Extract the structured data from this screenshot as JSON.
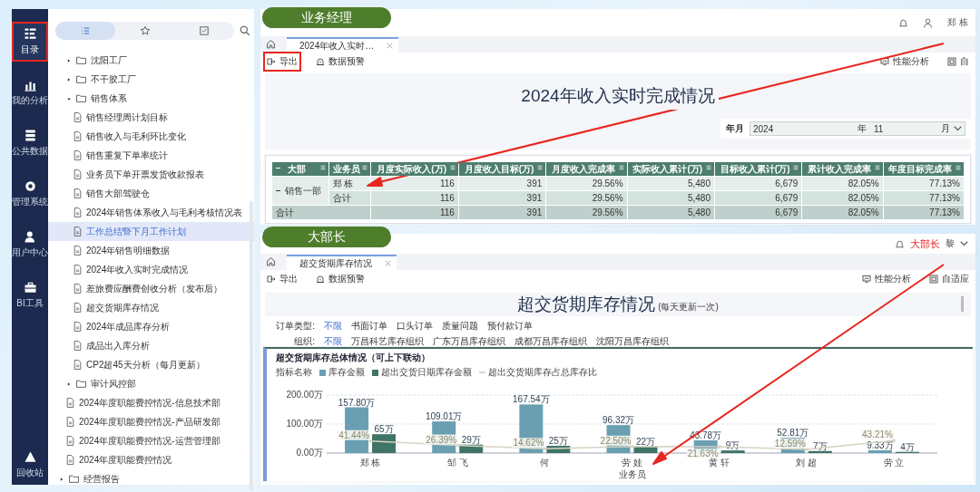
{
  "nav": {
    "items": [
      {
        "label": "目录",
        "selected": true,
        "highlighted": true
      },
      {
        "label": "我的分析",
        "selected": false,
        "highlighted": false
      },
      {
        "label": "公共数据",
        "selected": false,
        "highlighted": false
      },
      {
        "label": "管理系统",
        "selected": false,
        "highlighted": false
      },
      {
        "label": "用户中心",
        "selected": false,
        "highlighted": false
      },
      {
        "label": "BI工具",
        "selected": false,
        "highlighted": false
      }
    ],
    "bottom_item": {
      "label": "回收站"
    }
  },
  "tree": {
    "tabs": [
      {
        "selected": true
      },
      {
        "selected": false
      },
      {
        "selected": false
      }
    ],
    "items": [
      {
        "kind": "folder",
        "label": "沈阳工厂",
        "expanded": false,
        "selected": false
      },
      {
        "kind": "folder",
        "label": "不干胶工厂",
        "expanded": false,
        "selected": false
      },
      {
        "kind": "folder",
        "label": "销售体系",
        "expanded": true,
        "selected": false,
        "children": [
          {
            "kind": "file",
            "label": "销售经理周计划目标",
            "selected": false
          },
          {
            "kind": "file",
            "label": "销售收入与毛利环比变化",
            "selected": false
          },
          {
            "kind": "file",
            "label": "销售重复下单率统计",
            "selected": false
          },
          {
            "kind": "file",
            "label": "业务员下单开票发货收款报表",
            "selected": false
          },
          {
            "kind": "file",
            "label": "销售大部驾驶仓",
            "selected": false
          },
          {
            "kind": "file",
            "label": "2024年销售体系收入与毛利考核情况表",
            "selected": false
          },
          {
            "kind": "file",
            "label": "工作总结暨下月工作计划",
            "selected": true
          },
          {
            "kind": "file",
            "label": "2024年销售明细数据",
            "selected": false
          },
          {
            "kind": "file",
            "label": "2024年收入实时完成情况",
            "selected": false
          },
          {
            "kind": "file",
            "label": "差旅费应酬费创收分析（发布后）",
            "selected": false
          },
          {
            "kind": "file",
            "label": "超交货期库存情况",
            "selected": false
          },
          {
            "kind": "file",
            "label": "2024年成品库存分析",
            "selected": false
          },
          {
            "kind": "file",
            "label": "成品出入库分析",
            "selected": false
          },
          {
            "kind": "file",
            "label": "CP2超45天分析（每月更新）",
            "selected": false
          }
        ]
      },
      {
        "kind": "folder",
        "label": "审计风控部",
        "expanded": false,
        "selected": false
      },
      {
        "kind": "file",
        "label": "2024年度职能费控情况-信息技术部",
        "selected": false
      },
      {
        "kind": "file",
        "label": "2024年度职能费控情况-产品研发部",
        "selected": false
      },
      {
        "kind": "file",
        "label": "2024年度职能费控情况-运营管理部",
        "selected": false
      },
      {
        "kind": "file",
        "label": "2024年度职能费控情况",
        "selected": false
      }
    ],
    "root_items": [
      {
        "kind": "folder",
        "label": "经营报告",
        "expanded": false,
        "selected": false
      }
    ]
  },
  "panels": [
    {
      "role": "业务经理",
      "user": "郑 栋",
      "tab": "2024年收入实时…",
      "toolbar": [
        {
          "label": "导出",
          "highlighted": true
        },
        {
          "label": "数据预警",
          "highlighted": false
        }
      ],
      "toolbar_right": [
        {
          "label": "性能分析"
        },
        {
          "label": "自"
        }
      ],
      "report": {
        "kind": "table",
        "title": "2024年收入实时完成情况",
        "filter": {
          "label": "年月",
          "year": "2024",
          "year_unit": "年",
          "month": "11",
          "month_unit": "月"
        },
        "columns": [
          "大部",
          "业务员",
          "月度实际收入(万)",
          "月度收入目标(万)",
          "月度收入完成率",
          "实际收入累计(万)",
          "目标收入累计(万)",
          "累计收入完成率",
          "年度目标完成率"
        ],
        "groups": [
          {
            "name": "销售一部",
            "expanded": true,
            "rows": [
              {
                "person": "郑 栋",
                "values": [
                  "116",
                  "391",
                  "29.56%",
                  "5,480",
                  "6,679",
                  "82.05%",
                  "77.13%"
                ]
              },
              {
                "person": "合计",
                "values": [
                  "116",
                  "391",
                  "29.56%",
                  "5,480",
                  "6,679",
                  "82.05%",
                  "77.13%"
                ]
              }
            ]
          }
        ],
        "total": {
          "label": "合计",
          "values": [
            "116",
            "391",
            "29.56%",
            "5,480",
            "6,679",
            "82.05%",
            "77.13%"
          ]
        }
      }
    },
    {
      "role": "大部长",
      "role_note": "大部长",
      "user": "黎",
      "tab": "超交货期库存情况",
      "toolbar": [
        {
          "label": "导出",
          "highlighted": false
        },
        {
          "label": "数据预警",
          "highlighted": false
        }
      ],
      "toolbar_right": [
        {
          "label": "性能分析"
        },
        {
          "label": "自适应"
        }
      ],
      "report": {
        "kind": "chart",
        "title": "超交货期库存情况",
        "subtitle": "(每天更新一次)",
        "filters": [
          {
            "label": "订单类型:",
            "options": [
              {
                "label": "不限",
                "selected": true
              },
              {
                "label": "书面订单",
                "selected": false
              },
              {
                "label": "口头订单",
                "selected": false
              },
              {
                "label": "质量问题",
                "selected": false
              },
              {
                "label": "预付款订单",
                "selected": false
              }
            ]
          },
          {
            "label": "组织:",
            "options": [
              {
                "label": "不限",
                "selected": true
              },
              {
                "label": "万昌科艺库存组织",
                "selected": false
              },
              {
                "label": "广东万昌库存组织",
                "selected": false
              },
              {
                "label": "成都万昌库存组织",
                "selected": false
              },
              {
                "label": "沈阳万昌库存组织",
                "selected": false
              }
            ]
          }
        ],
        "card_title": "超交货期库存总体情况（可上下联动）",
        "legend_label": "指标名称",
        "chart_data": {
          "type": "bar",
          "stacked": false,
          "xlabel": "业务员",
          "categories": [
            "郑 栋",
            "邹 飞",
            "何",
            "劳 娃",
            "黄 轩",
            "刘 超",
            "劳 立"
          ],
          "ylim": [
            0,
            200
          ],
          "yticks": [
            {
              "value": 0,
              "label": "0.00万"
            },
            {
              "value": 100,
              "label": "100.00万"
            },
            {
              "value": 200,
              "label": "200.00万"
            }
          ],
          "series": [
            {
              "name": "库存金额",
              "type": "bar",
              "color": "#6a9fb2",
              "values": [
                157.8,
                109.01,
                167.54,
                96.32,
                43.78,
                52.81,
                9.33
              ],
              "value_labels": [
                "157.80万",
                "109.01万",
                "167.54万",
                "96.32万",
                "43.78万",
                "52.81万",
                "9.33万"
              ]
            },
            {
              "name": "超出交货日期库存金额",
              "type": "bar",
              "color": "#3f7466",
              "values": [
                65,
                29,
                25,
                22,
                9,
                7,
                4
              ],
              "value_labels": [
                "65万",
                "29万",
                "25万",
                "22万",
                "9万",
                "7万",
                "4万"
              ]
            },
            {
              "name": "超出交货期库存占总库存比",
              "type": "line",
              "color": "#d6d3c4",
              "values": [
                41.44,
                26.39,
                14.62,
                22.5,
                21.63,
                12.59,
                43.21
              ],
              "value_labels": [
                "41.44%",
                "26.39%",
                "14.62%",
                "22.50%",
                "21.63%",
                "12.59%",
                "43.21%"
              ]
            }
          ]
        }
      }
    }
  ]
}
